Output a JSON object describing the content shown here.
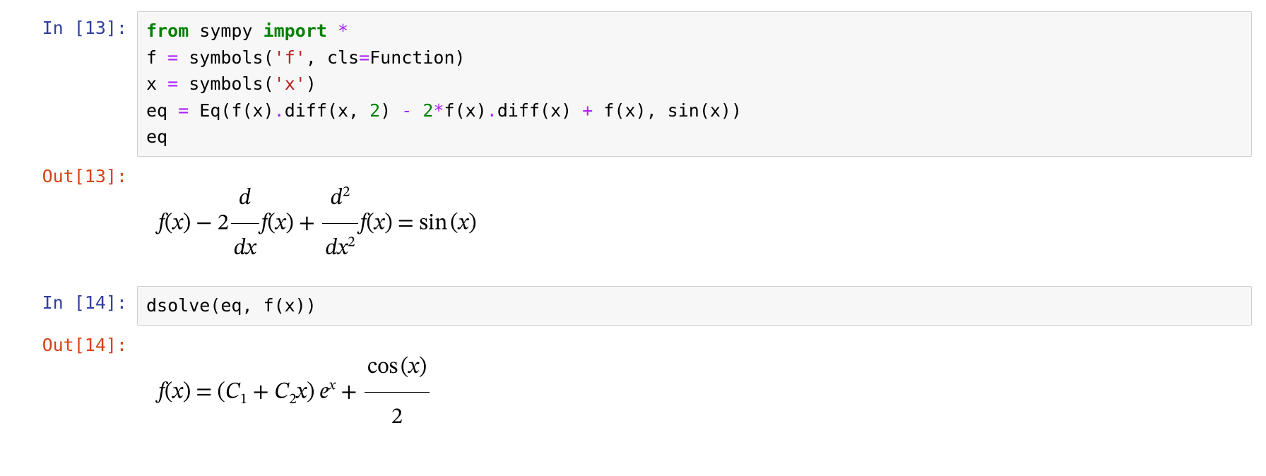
{
  "cells": {
    "c13": {
      "in_prompt": "In [13]:",
      "out_prompt": "Out[13]:",
      "code": {
        "t_from": "from",
        "t_sympy": " sympy ",
        "t_import": "import",
        "t_star": " *",
        "l2a": "f ",
        "op_eq1": "=",
        "l2b": " symbols(",
        "s_f": "'f'",
        "l2c": ", cls",
        "op_eq2": "=",
        "l2d": "Function)",
        "l3a": "x ",
        "op_eq3": "=",
        "l3b": " symbols(",
        "s_x": "'x'",
        "l3c": ")",
        "l4a": "eq ",
        "op_eq4": "=",
        "l4b": " Eq(f(x)",
        "dot1": ".",
        "diff1": "diff(x, ",
        "n2a": "2",
        "l4c": ") ",
        "minus": "-",
        "sp1": " ",
        "n2b": "2",
        "star": "*",
        "l4d": "f(x)",
        "dot2": ".",
        "diff2": "diff(x) ",
        "plus": "+",
        "l4e": " f(x), sin(x))",
        "l5": "eq"
      },
      "math": {
        "lhs_a": "f",
        "open1": "(",
        "x1": "x",
        "close1": ")",
        "minus": " − 2",
        "d_top": "d",
        "d_bot_d": "d",
        "d_bot_x": "x",
        "fx2": "f",
        "open2": "(",
        "x2": "x",
        "close2": ")",
        "plus": " + ",
        "d2_top_d": "d",
        "d2_top_2": "2",
        "d2_bot_d": "d",
        "d2_bot_x": "x",
        "d2_bot_2": "2",
        "fx3": "f",
        "open3": "(",
        "x3": "x",
        "close3": ")",
        "eq": " = ",
        "sin": "sin",
        "open4": "(",
        "x4": "x",
        "close4": ")"
      }
    },
    "c14": {
      "in_prompt": "In [14]:",
      "out_prompt": "Out[14]:",
      "code": {
        "a": "dsolve(eq, f(x))"
      },
      "math": {
        "fx": "f",
        "open1": "(",
        "x1": "x",
        "close1": ")",
        "eq": " = ",
        "open_p": "(",
        "C1": "C",
        "one": "1",
        "plus1": " + ",
        "C2": "C",
        "two": "2",
        "xc": "x",
        "close_p": ")",
        "sp": " ",
        "e": "e",
        "expx": "x",
        "plus2": " + ",
        "cos": "cos",
        "open2": "(",
        "x2": "x",
        "close2": ")",
        "den2": "2"
      }
    }
  }
}
